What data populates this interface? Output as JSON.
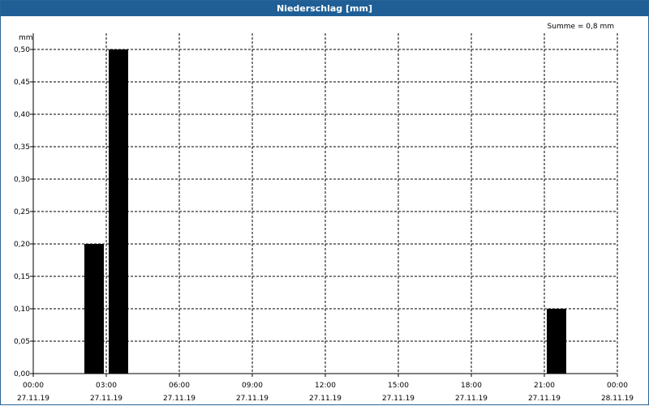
{
  "window": {
    "title": "Niederschlag [mm]"
  },
  "summary": "Summe = 0,8 mm",
  "chart_data": {
    "type": "bar",
    "title": "Niederschlag [mm]",
    "ylabel": "mm",
    "ylim": [
      0,
      0.5
    ],
    "yticks": [
      "0,00",
      "0,05",
      "0,10",
      "0,15",
      "0,20",
      "0,25",
      "0,30",
      "0,35",
      "0,40",
      "0,45",
      "0,50"
    ],
    "xlim_hours": [
      0,
      24
    ],
    "xticks": [
      {
        "time": "00:00",
        "date": "27.11.19"
      },
      {
        "time": "03:00",
        "date": "27.11.19"
      },
      {
        "time": "06:00",
        "date": "27.11.19"
      },
      {
        "time": "09:00",
        "date": "27.11.19"
      },
      {
        "time": "12:00",
        "date": "27.11.19"
      },
      {
        "time": "15:00",
        "date": "27.11.19"
      },
      {
        "time": "18:00",
        "date": "27.11.19"
      },
      {
        "time": "21:00",
        "date": "27.11.19"
      },
      {
        "time": "00:00",
        "date": "28.11.19"
      }
    ],
    "bars": [
      {
        "start": "02:00",
        "end": "03:00",
        "value": 0.2
      },
      {
        "start": "03:00",
        "end": "04:00",
        "value": 0.5
      },
      {
        "start": "21:00",
        "end": "22:00",
        "value": 0.1
      }
    ],
    "grid": true,
    "colors": {
      "bar": "#000000",
      "title_bar": "#1f5f96"
    }
  }
}
